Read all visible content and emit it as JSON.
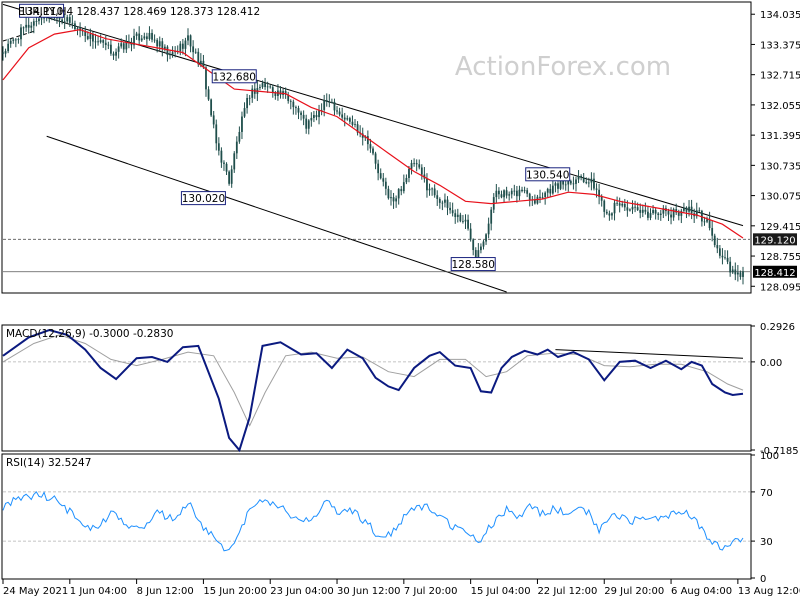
{
  "watermark": "ActionForex.com",
  "colors": {
    "candle": "#1f4e4b",
    "ma": "#e8111b",
    "channel": "#000000",
    "macd": "#0b1a80",
    "signal": "#a0a0a0",
    "rsi": "#1e90ff",
    "grid": "#b0b0b0",
    "label_border": "#1a237e",
    "label_fill": "#ffffff"
  },
  "panels": {
    "price": {
      "title": "EURJPY,H4  128.437 128.469 128.373 128.412"
    },
    "macd": {
      "title": "MACD(12,26,9) -0.3000 -0.2830"
    },
    "rsi": {
      "title": "RSI(14) 32.5247"
    }
  },
  "x_axis": {
    "labels": [
      "24 May 2021",
      "1 Jun 04:00",
      "8 Jun 12:00",
      "15 Jun 20:00",
      "23 Jun 04:00",
      "30 Jun 12:00",
      "7 Jul 20:00",
      "15 Jul 04:00",
      "22 Jul 12:00",
      "29 Jul 20:00",
      "6 Aug 04:00",
      "13 Aug 12:00"
    ]
  },
  "chart_data": [
    {
      "type": "candlestick",
      "title": "EURJPY,H4",
      "ylim": [
        127.97,
        134.28
      ],
      "y_ticks": [
        "134.035",
        "133.375",
        "132.715",
        "132.055",
        "131.395",
        "130.735",
        "130.075",
        "129.415",
        "128.755",
        "128.095"
      ],
      "price_markers": [
        {
          "value": 129.12,
          "label": "129.120",
          "style": "dashed"
        },
        {
          "value": 128.412,
          "label": "128.412",
          "style": "solid"
        }
      ],
      "close_path": [
        [
          0,
          133.2
        ],
        [
          8,
          133.7
        ],
        [
          15,
          134.0
        ],
        [
          20,
          134.05
        ],
        [
          27,
          133.8
        ],
        [
          35,
          133.5
        ],
        [
          43,
          133.2
        ],
        [
          50,
          133.45
        ],
        [
          55,
          133.6
        ],
        [
          60,
          133.4
        ],
        [
          65,
          133.1
        ],
        [
          72,
          133.5
        ],
        [
          78,
          132.8
        ],
        [
          83,
          131.2
        ],
        [
          88,
          130.4
        ],
        [
          92,
          131.5
        ],
        [
          96,
          132.3
        ],
        [
          101,
          132.5
        ],
        [
          108,
          132.3
        ],
        [
          113,
          132.1
        ],
        [
          118,
          131.6
        ],
        [
          123,
          131.9
        ],
        [
          127,
          132.2
        ],
        [
          132,
          131.8
        ],
        [
          137,
          131.6
        ],
        [
          142,
          131.3
        ],
        [
          147,
          130.4
        ],
        [
          152,
          129.9
        ],
        [
          156,
          130.4
        ],
        [
          160,
          130.8
        ],
        [
          165,
          130.3
        ],
        [
          170,
          130.0
        ],
        [
          175,
          129.7
        ],
        [
          180,
          129.5
        ],
        [
          184,
          128.8
        ],
        [
          188,
          129.3
        ],
        [
          192,
          130.2
        ],
        [
          197,
          130.05
        ],
        [
          202,
          130.2
        ],
        [
          207,
          130.0
        ],
        [
          212,
          130.2
        ],
        [
          216,
          130.3
        ],
        [
          220,
          130.4
        ],
        [
          225,
          130.5
        ],
        [
          230,
          130.3
        ],
        [
          235,
          129.7
        ],
        [
          240,
          129.9
        ],
        [
          245,
          129.75
        ],
        [
          250,
          129.65
        ],
        [
          255,
          129.75
        ],
        [
          260,
          129.65
        ],
        [
          265,
          129.8
        ],
        [
          270,
          129.7
        ],
        [
          274,
          129.5
        ],
        [
          278,
          128.9
        ],
        [
          282,
          128.55
        ],
        [
          285,
          128.3
        ],
        [
          288,
          128.4
        ]
      ],
      "moving_average": [
        [
          0,
          132.6
        ],
        [
          10,
          133.3
        ],
        [
          20,
          133.6
        ],
        [
          30,
          133.7
        ],
        [
          40,
          133.5
        ],
        [
          50,
          133.4
        ],
        [
          60,
          133.3
        ],
        [
          70,
          133.2
        ],
        [
          80,
          132.8
        ],
        [
          90,
          132.4
        ],
        [
          100,
          132.35
        ],
        [
          110,
          132.3
        ],
        [
          120,
          132.0
        ],
        [
          130,
          131.8
        ],
        [
          140,
          131.4
        ],
        [
          150,
          131.0
        ],
        [
          160,
          130.6
        ],
        [
          170,
          130.3
        ],
        [
          180,
          129.95
        ],
        [
          190,
          129.9
        ],
        [
          200,
          129.95
        ],
        [
          210,
          130.0
        ],
        [
          220,
          130.15
        ],
        [
          230,
          130.1
        ],
        [
          240,
          129.95
        ],
        [
          250,
          129.85
        ],
        [
          260,
          129.75
        ],
        [
          270,
          129.65
        ],
        [
          280,
          129.45
        ],
        [
          288,
          129.15
        ]
      ],
      "channel_lines": [
        {
          "from": [
            0,
            134.25
          ],
          "to": [
            288,
            129.42
          ]
        },
        {
          "from": [
            17,
            131.37
          ],
          "to": [
            196,
            127.97
          ]
        }
      ],
      "annotations": [
        {
          "label": "134.110",
          "x": 15,
          "value": 134.11
        },
        {
          "label": "132.680",
          "x": 90,
          "value": 132.68
        },
        {
          "label": "130.020",
          "x": 78,
          "value": 130.02
        },
        {
          "label": "128.580",
          "x": 183,
          "value": 128.58
        },
        {
          "label": "130.540",
          "x": 212,
          "value": 130.54
        }
      ]
    },
    {
      "type": "line",
      "title": "MACD(12,26,9)",
      "ylim": [
        -0.7185,
        0.2926
      ],
      "y_ticks": [
        "0.2926",
        "0.00",
        "-0.7185"
      ],
      "zero_line": 0,
      "series": [
        {
          "name": "MACD",
          "points": [
            [
              0,
              0.05
            ],
            [
              10,
              0.2
            ],
            [
              18,
              0.26
            ],
            [
              25,
              0.22
            ],
            [
              32,
              0.1
            ],
            [
              38,
              -0.05
            ],
            [
              44,
              -0.14
            ],
            [
              52,
              0.03
            ],
            [
              58,
              0.04
            ],
            [
              64,
              0.0
            ],
            [
              70,
              0.12
            ],
            [
              76,
              0.13
            ],
            [
              84,
              -0.3
            ],
            [
              88,
              -0.62
            ],
            [
              92,
              -0.72
            ],
            [
              96,
              -0.45
            ],
            [
              101,
              0.13
            ],
            [
              108,
              0.16
            ],
            [
              116,
              0.06
            ],
            [
              122,
              0.07
            ],
            [
              128,
              -0.05
            ],
            [
              134,
              0.1
            ],
            [
              140,
              0.03
            ],
            [
              145,
              -0.13
            ],
            [
              150,
              -0.2
            ],
            [
              154,
              -0.23
            ],
            [
              160,
              -0.05
            ],
            [
              166,
              0.05
            ],
            [
              170,
              0.08
            ],
            [
              176,
              -0.03
            ],
            [
              182,
              -0.05
            ],
            [
              186,
              -0.24
            ],
            [
              190,
              -0.25
            ],
            [
              194,
              -0.05
            ],
            [
              198,
              0.04
            ],
            [
              203,
              0.09
            ],
            [
              208,
              0.06
            ],
            [
              212,
              0.1
            ],
            [
              216,
              0.04
            ],
            [
              222,
              0.08
            ],
            [
              228,
              0.02
            ],
            [
              234,
              -0.15
            ],
            [
              240,
              0.0
            ],
            [
              246,
              0.01
            ],
            [
              252,
              -0.05
            ],
            [
              258,
              0.01
            ],
            [
              264,
              -0.06
            ],
            [
              268,
              0.0
            ],
            [
              272,
              -0.03
            ],
            [
              276,
              -0.18
            ],
            [
              281,
              -0.25
            ],
            [
              284,
              -0.27
            ],
            [
              288,
              -0.26
            ]
          ]
        },
        {
          "name": "Signal",
          "points": [
            [
              0,
              0.0
            ],
            [
              12,
              0.15
            ],
            [
              22,
              0.22
            ],
            [
              32,
              0.15
            ],
            [
              42,
              0.02
            ],
            [
              52,
              -0.03
            ],
            [
              62,
              0.02
            ],
            [
              72,
              0.08
            ],
            [
              82,
              0.05
            ],
            [
              90,
              -0.25
            ],
            [
              96,
              -0.52
            ],
            [
              102,
              -0.25
            ],
            [
              110,
              0.05
            ],
            [
              120,
              0.08
            ],
            [
              130,
              0.03
            ],
            [
              140,
              0.04
            ],
            [
              150,
              -0.08
            ],
            [
              160,
              -0.12
            ],
            [
              170,
              0.02
            ],
            [
              180,
              0.02
            ],
            [
              188,
              -0.12
            ],
            [
              196,
              -0.08
            ],
            [
              204,
              0.05
            ],
            [
              214,
              0.07
            ],
            [
              224,
              0.06
            ],
            [
              234,
              -0.03
            ],
            [
              244,
              -0.04
            ],
            [
              254,
              -0.02
            ],
            [
              264,
              -0.02
            ],
            [
              274,
              -0.08
            ],
            [
              282,
              -0.18
            ],
            [
              288,
              -0.23
            ]
          ]
        }
      ],
      "trend_line": {
        "from": [
          215,
          0.1
        ],
        "to": [
          288,
          0.03
        ]
      }
    },
    {
      "type": "line",
      "title": "RSI(14)",
      "ylim": [
        0,
        100
      ],
      "y_ticks": [
        100,
        70,
        30,
        0
      ],
      "levels": [
        70,
        30
      ],
      "series": [
        {
          "name": "RSI",
          "points": [
            [
              0,
              58
            ],
            [
              6,
              64
            ],
            [
              12,
              68
            ],
            [
              18,
              66
            ],
            [
              24,
              58
            ],
            [
              30,
              45
            ],
            [
              36,
              40
            ],
            [
              42,
              52
            ],
            [
              48,
              45
            ],
            [
              54,
              38
            ],
            [
              60,
              53
            ],
            [
              66,
              48
            ],
            [
              72,
              62
            ],
            [
              78,
              42
            ],
            [
              84,
              28
            ],
            [
              88,
              22
            ],
            [
              92,
              35
            ],
            [
              96,
              56
            ],
            [
              102,
              63
            ],
            [
              108,
              58
            ],
            [
              114,
              48
            ],
            [
              120,
              46
            ],
            [
              126,
              62
            ],
            [
              130,
              52
            ],
            [
              136,
              54
            ],
            [
              142,
              44
            ],
            [
              148,
              30
            ],
            [
              152,
              38
            ],
            [
              158,
              54
            ],
            [
              164,
              58
            ],
            [
              168,
              56
            ],
            [
              174,
              42
            ],
            [
              180,
              38
            ],
            [
              186,
              30
            ],
            [
              190,
              44
            ],
            [
              196,
              56
            ],
            [
              200,
              47
            ],
            [
              204,
              58
            ],
            [
              210,
              52
            ],
            [
              214,
              56
            ],
            [
              220,
              52
            ],
            [
              226,
              58
            ],
            [
              232,
              40
            ],
            [
              238,
              52
            ],
            [
              244,
              46
            ],
            [
              250,
              50
            ],
            [
              256,
              48
            ],
            [
              262,
              52
            ],
            [
              266,
              52
            ],
            [
              270,
              46
            ],
            [
              274,
              34
            ],
            [
              278,
              26
            ],
            [
              282,
              24
            ],
            [
              286,
              32
            ],
            [
              288,
              32.5
            ]
          ]
        }
      ]
    }
  ]
}
